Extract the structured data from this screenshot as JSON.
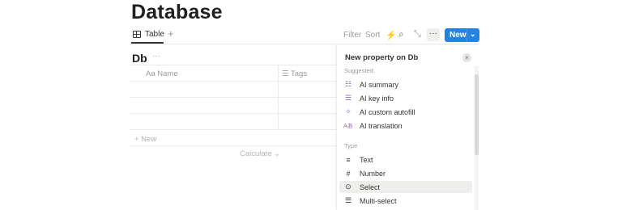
{
  "page": {
    "title": "Database"
  },
  "view": {
    "tab_label": "Table",
    "add_symbol": "+"
  },
  "toolbar": {
    "filter_label": "Filter",
    "sort_label": "Sort",
    "automation_icon": "⚡",
    "search_icon": "⌕",
    "expand_icon": "⤡",
    "more_label": "···",
    "new_label": "New",
    "new_chevron": "⌄",
    "new_color": "#2383e2"
  },
  "database": {
    "title": "Db",
    "more_label": "···",
    "columns": [
      {
        "icon": "Aa",
        "label": "Name"
      },
      {
        "icon": "☰",
        "label": "Tags"
      }
    ],
    "new_row_label": "+ New",
    "calculate_label": "Calculate ⌄"
  },
  "panel": {
    "title": "New property on Db",
    "close_symbol": "×",
    "suggested_label": "Suggested",
    "suggested": [
      {
        "icon": "☷",
        "label": "AI summary"
      },
      {
        "icon": "☰",
        "label": "AI key info"
      },
      {
        "icon": "✧",
        "label": "AI custom autofill"
      },
      {
        "icon": "Aあ",
        "label": "AI translation"
      }
    ],
    "type_label": "Type",
    "types": [
      {
        "icon": "≡",
        "label": "Text"
      },
      {
        "icon": "#",
        "label": "Number"
      },
      {
        "icon": "⊙",
        "label": "Select"
      },
      {
        "icon": "☰",
        "label": "Multi-select"
      }
    ],
    "selected_type": "Select"
  }
}
